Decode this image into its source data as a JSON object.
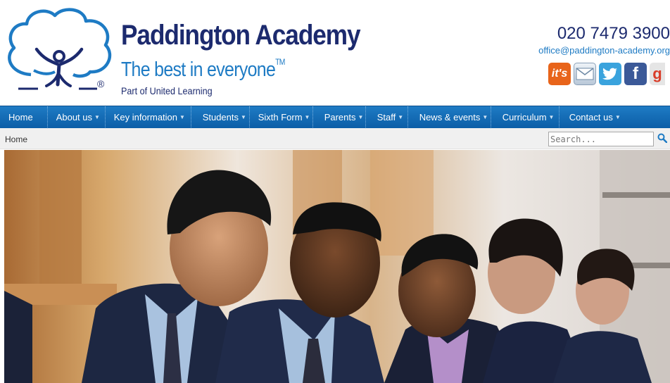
{
  "site": {
    "name": "Paddington Academy",
    "tagline": "The best in everyone",
    "trademark": "TM",
    "registered": "®",
    "subtitle": "Part of United Learning"
  },
  "contact": {
    "phone": "020 7479 3900",
    "email": "office@paddington-academy.org"
  },
  "social": [
    {
      "name": "its-icon",
      "label": "it's"
    },
    {
      "name": "email-icon",
      "label": ""
    },
    {
      "name": "twitter-icon",
      "label": ""
    },
    {
      "name": "facebook-icon",
      "label": "f"
    },
    {
      "name": "google-plus-icon",
      "label": "g"
    }
  ],
  "nav": {
    "items": [
      {
        "label": "Home"
      },
      {
        "label": "About us"
      },
      {
        "label": "Key information"
      },
      {
        "label": "Students"
      },
      {
        "label": "Sixth Form"
      },
      {
        "label": "Parents"
      },
      {
        "label": "Staff"
      },
      {
        "label": "News & events"
      },
      {
        "label": "Curriculum"
      },
      {
        "label": "Contact us"
      }
    ],
    "caret": "▼"
  },
  "breadcrumb": {
    "current": "Home"
  },
  "search": {
    "placeholder": "Search..."
  },
  "colors": {
    "brand_navy": "#1c2a6e",
    "brand_blue": "#1e7bc4",
    "nav_blue": "#0c5ea7"
  }
}
